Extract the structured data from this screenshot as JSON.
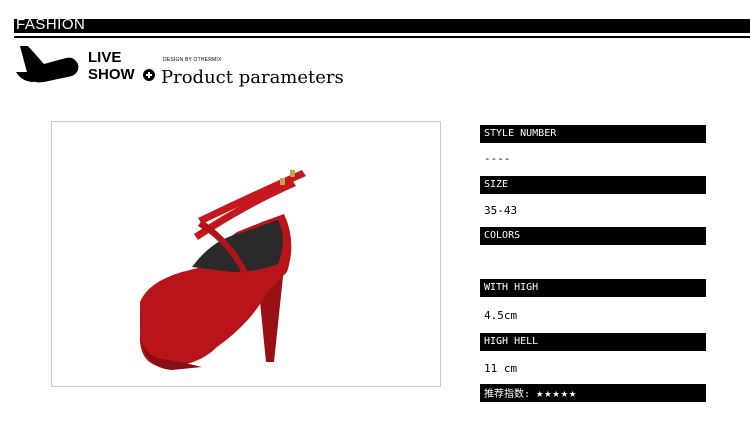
{
  "header": {
    "brand": "FASHION",
    "logo_line1": "LIVE",
    "logo_line2": "SHOW",
    "logo_plus_icon": "plus-circle-icon",
    "design_by": "DESIGN BY OTHERMIX",
    "title": "Product parameters"
  },
  "product_image": {
    "description_icon": "red-suede-high-heel-pump"
  },
  "params": [
    {
      "label": "STYLE NUMBER",
      "value": "----"
    },
    {
      "label": "SIZE",
      "value": "35-43"
    },
    {
      "label": "COLORS",
      "value": ""
    },
    {
      "label": "WITH HIGH",
      "value": "4.5cm"
    },
    {
      "label": "HIGH HELL",
      "value": "11 cm"
    }
  ],
  "rating": {
    "label": "推荐指数:",
    "stars": "★★★★★",
    "score": 5,
    "max": 5
  },
  "colors": {
    "accent": "#000000",
    "shoe": "#b8141a"
  }
}
